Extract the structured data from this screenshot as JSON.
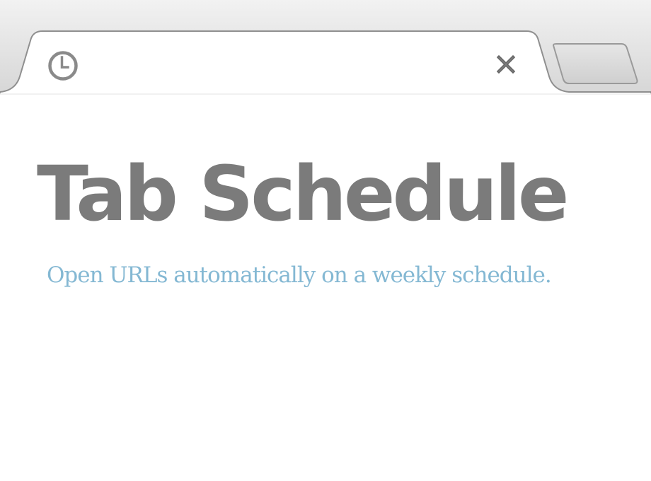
{
  "tab": {
    "icon": "clock-icon",
    "close_icon": "close-icon"
  },
  "new_tab": {
    "icon": "new-tab-button"
  },
  "page": {
    "title": "Tab Schedule",
    "subtitle": "Open URLs automatically on a weekly schedule."
  },
  "colors": {
    "title": "#7b7b7b",
    "subtitle": "#84b8d3",
    "chrome_frame": "#d9d9d9",
    "tab_background": "#ffffff"
  }
}
